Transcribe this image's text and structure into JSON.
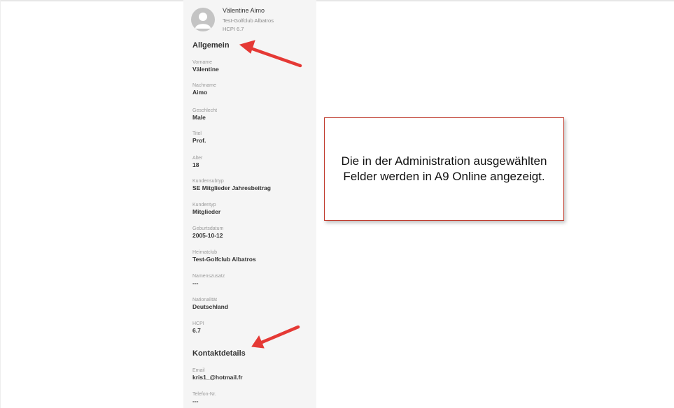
{
  "profile": {
    "name": "Välentine Aimo",
    "club": "Test-Golfclub Albatros",
    "hcpi": "HCPI 6.7",
    "avatar_icon": "user-icon"
  },
  "sections": {
    "general": "Allgemein",
    "contact": "Kontaktdetails"
  },
  "fields": [
    {
      "label": "Vorname",
      "value": "Välentine"
    },
    {
      "label": "Nachname",
      "value": "Aimo"
    },
    {
      "label": "Geschlecht",
      "value": "Male"
    },
    {
      "label": "Titel",
      "value": "Prof."
    },
    {
      "label": "Alter",
      "value": "18"
    },
    {
      "label": "Kundensubtyp",
      "value": "SE Mitglieder Jahresbeitrag"
    },
    {
      "label": "Kundentyp",
      "value": "Mitglieder"
    },
    {
      "label": "Geburtsdatum",
      "value": "2005-10-12"
    },
    {
      "label": "Heimatclub",
      "value": "Test-Golfclub Albatros"
    },
    {
      "label": "Namenszusatz",
      "value": "---"
    },
    {
      "label": "Nationalität",
      "value": "Deutschland"
    },
    {
      "label": "HCPI",
      "value": "6.7"
    }
  ],
  "contact_fields": [
    {
      "label": "Email",
      "value": "kris1_@hotmail.fr"
    },
    {
      "label": "Telefon-Nr.",
      "value": "---"
    }
  ],
  "callout": {
    "text": "Die in der Administration ausgewählten Felder werden in A9 Online angezeigt."
  },
  "colors": {
    "annotation_arrow": "#e53935",
    "callout_border": "#c0392b",
    "panel_background": "#f5f5f5"
  }
}
